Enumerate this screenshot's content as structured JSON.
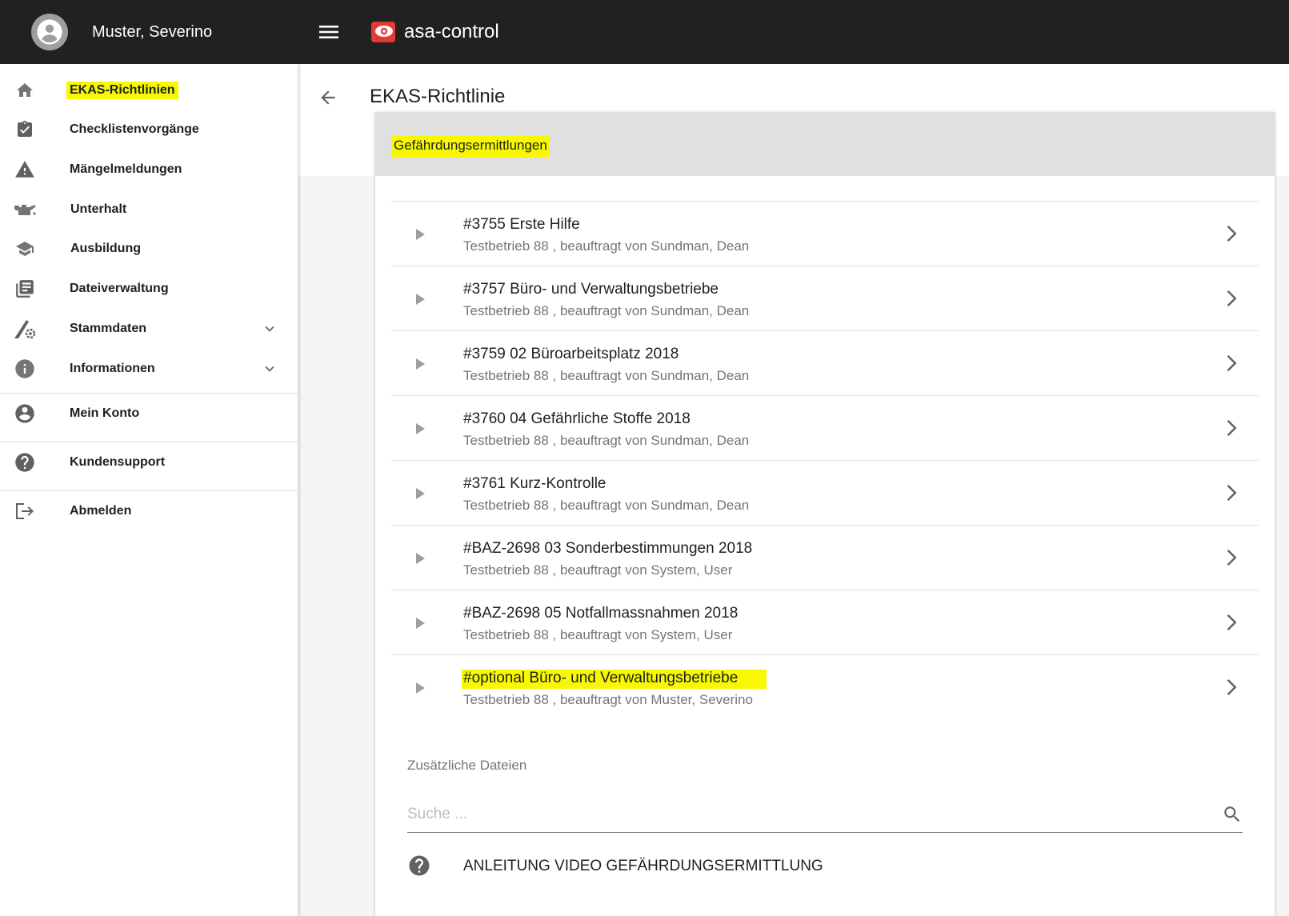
{
  "user": {
    "name": "Muster, Severino"
  },
  "app": {
    "title": "asa-control"
  },
  "sidebar": {
    "items": [
      {
        "label": "EKAS-Richtlinien",
        "icon": "home-icon"
      },
      {
        "label": "Checklistenvorgänge",
        "icon": "clipboard-check-icon"
      },
      {
        "label": "Mängelmeldungen",
        "icon": "warning-icon"
      },
      {
        "label": "Unterhalt",
        "icon": "oil-can-icon"
      },
      {
        "label": "Ausbildung",
        "icon": "graduation-cap-icon"
      },
      {
        "label": "Dateiverwaltung",
        "icon": "file-library-icon"
      },
      {
        "label": "Stammdaten",
        "icon": "settings-tool-icon"
      },
      {
        "label": "Informationen",
        "icon": "info-icon"
      },
      {
        "label": "Mein Konto",
        "icon": "account-icon"
      },
      {
        "label": "Kundensupport",
        "icon": "help-icon"
      },
      {
        "label": "Abmelden",
        "icon": "logout-icon"
      }
    ]
  },
  "main": {
    "title": "EKAS-Richtlinie",
    "card_header": "Gefährdungsermittlungen",
    "rows": [
      {
        "title": "#3755 Erste Hilfe",
        "subtitle": "Testbetrieb 88 , beauftragt von Sundman, Dean"
      },
      {
        "title": "#3757 Büro- und Verwaltungsbetriebe",
        "subtitle": "Testbetrieb 88 , beauftragt von Sundman, Dean"
      },
      {
        "title": "#3759 02 Büroarbeitsplatz 2018",
        "subtitle": "Testbetrieb 88 , beauftragt von Sundman, Dean"
      },
      {
        "title": "#3760 04 Gefährliche Stoffe 2018",
        "subtitle": "Testbetrieb 88 , beauftragt von Sundman, Dean"
      },
      {
        "title": "#3761 Kurz-Kontrolle",
        "subtitle": "Testbetrieb 88 , beauftragt von Sundman, Dean"
      },
      {
        "title": "#BAZ-2698 03 Sonderbestimmungen 2018",
        "subtitle": "Testbetrieb 88 , beauftragt von System, User"
      },
      {
        "title": "#BAZ-2698 05 Notfallmassnahmen 2018",
        "subtitle": "Testbetrieb 88 , beauftragt von System, User"
      },
      {
        "title": "#optional Büro- und Verwaltungsbetriebe",
        "subtitle": "Testbetrieb 88 , beauftragt von Muster, Severino"
      }
    ],
    "additional_files": {
      "label": "Zusätzliche Dateien",
      "search_placeholder": "Suche ...",
      "help_link": "ANLEITUNG VIDEO GEFÄHRDUNGSERMITTLUNG"
    }
  },
  "colors": {
    "highlight": "#f8f800",
    "appbar": "#212121",
    "brand": "#e53935"
  }
}
